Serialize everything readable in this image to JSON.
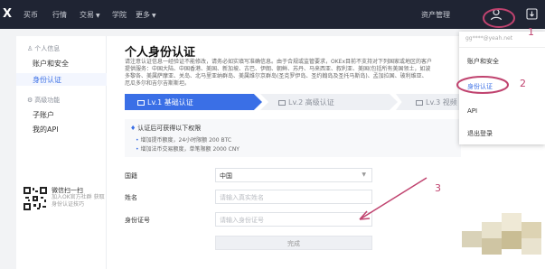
{
  "topbar": {
    "logo": "X",
    "nav": [
      "买币",
      "行情",
      "交易",
      "学院",
      "更多"
    ],
    "asset_label": "资产管理"
  },
  "sidebar": {
    "section1": "个人信息",
    "section1_items": [
      "账户和安全",
      "身份认证"
    ],
    "section2": "高级功能",
    "section2_items": [
      "子账户",
      "我的API"
    ],
    "qr_title": "微信扫一扫",
    "qr_sub": "加入OK官方社群 获取身份认证技巧"
  },
  "main": {
    "title": "个人身份认证",
    "intro": "请注意认证信息一经验证不能修改，请务必如实填写准确信息。由于合规或监管要求，OKEx目前不支持对下列国家或地区的客户提供服务：中国大陆、中国香港、美国、新加坡、古巴、伊朗、朝鲜、苏丹、马来西亚、叙利亚、美国(包括所有美国领土，如波多黎各、美属萨摩亚、关岛、北马里亚纳群岛、美属维尔京群岛(圣克罗伊岛、圣约翰岛及圣托马斯岛)、孟加拉国、玻利维亚、厄瓜多尔和吉尔吉斯斯坦。",
    "steps": [
      "Lv.1 基础认证",
      "Lv.2 高级认证",
      "Lv.3 视频"
    ],
    "perm_head": "认证后可获得以下权限",
    "perm_items": [
      "增加提币额度，24小时限额 200 BTC",
      "增加法币交易额度，单笔限额 2000 CNY"
    ],
    "fields": [
      {
        "label": "国籍",
        "value": "中国",
        "type": "select"
      },
      {
        "label": "姓名",
        "placeholder": "请输入真实姓名",
        "type": "input"
      },
      {
        "label": "身份证号",
        "placeholder": "请输入身份证号",
        "type": "input"
      }
    ],
    "submit": "完成"
  },
  "dropdown": {
    "account": "gg****@yeah.net",
    "items": [
      "账户和安全",
      "身份认证",
      "API",
      "退出登录"
    ]
  },
  "annotations": [
    "1",
    "2",
    "3"
  ],
  "colors": {
    "accent": "#3a6fe6",
    "annotation": "#c0436f",
    "topbar": "#1f2433"
  }
}
